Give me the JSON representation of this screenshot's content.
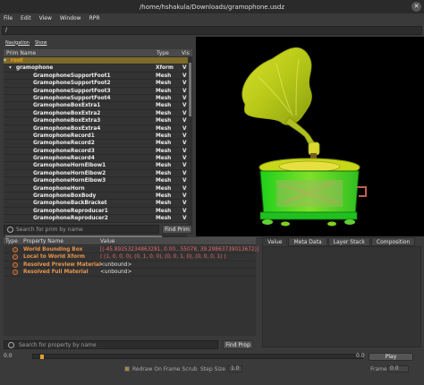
{
  "window": {
    "title": "/home/hshakula/Downloads/gramophone.usdz",
    "close_glyph": "✕"
  },
  "menu": [
    "File",
    "Edit",
    "View",
    "Window",
    "RPR"
  ],
  "path_field": "/",
  "prim_panel": {
    "subnav": [
      "Navigation",
      "Show"
    ],
    "columns": [
      "Prim Name",
      "Type",
      "Vis"
    ],
    "rows": [
      {
        "name": "root",
        "type": "",
        "vis": ""
      },
      {
        "name": "gramophone",
        "type": "Xform",
        "vis": "V"
      },
      {
        "name": "GramophoneSupportFoot1",
        "type": "Mesh",
        "vis": "V"
      },
      {
        "name": "GramophoneSupportFoot2",
        "type": "Mesh",
        "vis": "V"
      },
      {
        "name": "GramophoneSupportFoot3",
        "type": "Mesh",
        "vis": "V"
      },
      {
        "name": "GramophoneSupportFoot4",
        "type": "Mesh",
        "vis": "V"
      },
      {
        "name": "GramophoneBoxExtra1",
        "type": "Mesh",
        "vis": "V"
      },
      {
        "name": "GramophoneBoxExtra2",
        "type": "Mesh",
        "vis": "V"
      },
      {
        "name": "GramophoneBoxExtra3",
        "type": "Mesh",
        "vis": "V"
      },
      {
        "name": "GramophoneBoxExtra4",
        "type": "Mesh",
        "vis": "V"
      },
      {
        "name": "GramophoneRecord1",
        "type": "Mesh",
        "vis": "V"
      },
      {
        "name": "GramophoneRecord2",
        "type": "Mesh",
        "vis": "V"
      },
      {
        "name": "GramophoneRecord3",
        "type": "Mesh",
        "vis": "V"
      },
      {
        "name": "GramophoneRecord4",
        "type": "Mesh",
        "vis": "V"
      },
      {
        "name": "GramophoneHornElbow1",
        "type": "Mesh",
        "vis": "V"
      },
      {
        "name": "GramophoneHornElbow2",
        "type": "Mesh",
        "vis": "V"
      },
      {
        "name": "GramophoneHornElbow3",
        "type": "Mesh",
        "vis": "V"
      },
      {
        "name": "GramophoneHorn",
        "type": "Mesh",
        "vis": "V"
      },
      {
        "name": "GramophoneBoxBody",
        "type": "Mesh",
        "vis": "V"
      },
      {
        "name": "GramophoneBackBracket",
        "type": "Mesh",
        "vis": "V"
      },
      {
        "name": "GramophoneReproducer1",
        "type": "Mesh",
        "vis": "V"
      },
      {
        "name": "GramophoneReproducer2",
        "type": "Mesh",
        "vis": "V"
      }
    ],
    "search_placeholder": "Search for prim by name",
    "find_button": "Find Prim"
  },
  "property_panel": {
    "columns": [
      "Type",
      "Property Name",
      "Value"
    ],
    "rows": [
      {
        "name": "World Bounding Box",
        "value": "[(-45.89253234863281, 0.00...55078, 39.29863739013672)]",
        "muted": false
      },
      {
        "name": "Local to World Xform",
        "value": "( (1, 0, 0, 0), (0, 1, 0, 0), (0, 0, 1, 0), (0, 0, 0, 1) )",
        "muted": false
      },
      {
        "name": "Resolved Preview Material",
        "value": "<unbound>",
        "muted": true
      },
      {
        "name": "Resolved Full Material",
        "value": "<unbound>",
        "muted": true
      }
    ],
    "search_placeholder": "Search for property by name",
    "find_button": "Find Prop"
  },
  "tabs": [
    "Value",
    "Meta Data",
    "Layer Stack",
    "Composition"
  ],
  "timeline": {
    "start": "0.0",
    "end": "0.0",
    "play": "Play",
    "redraw_label": "Redraw On Frame Scrub",
    "step_label": "Step Size",
    "step_value": "1.0",
    "frame_label": "Frame:",
    "frame_value": "0.0"
  }
}
